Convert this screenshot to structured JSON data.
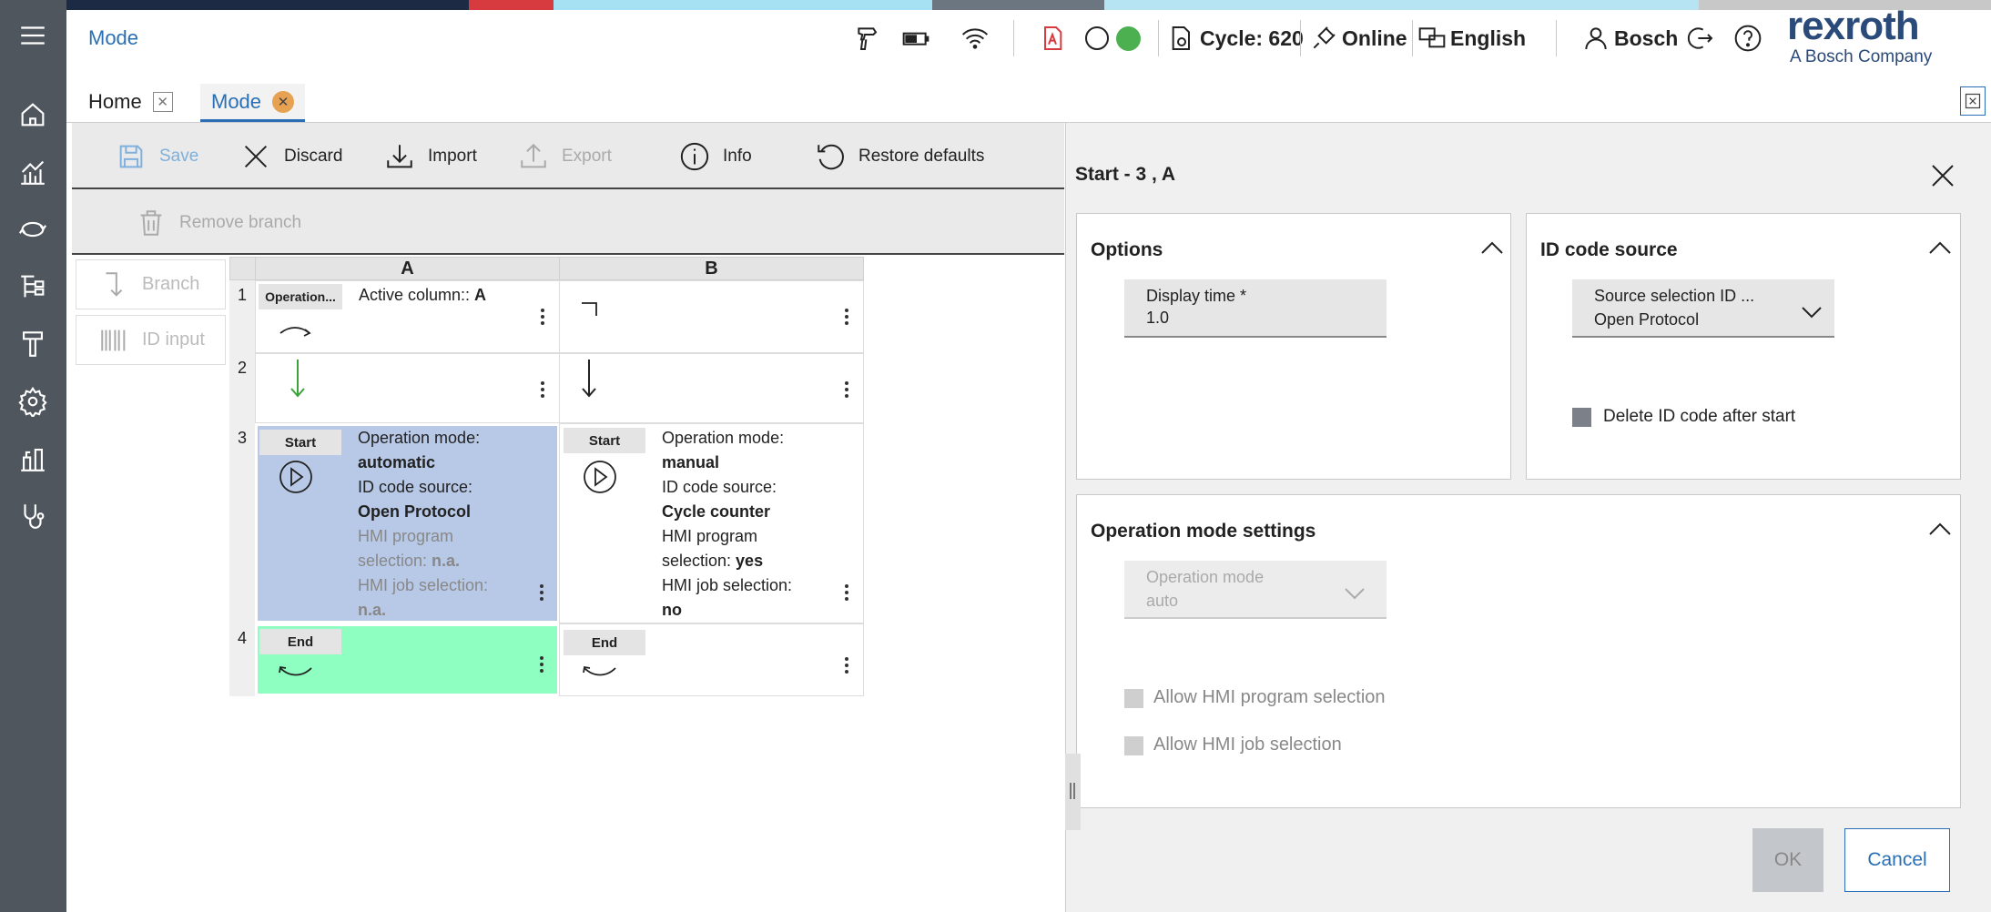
{
  "colors": {
    "sidebar": "#50565d",
    "accent": "#2a6fb5",
    "selected_cell": "#b8c9e8",
    "end_cell": "#8effc0",
    "start_arrow": "#3aa33a",
    "strip": [
      "#1c2b43",
      "#d73a3f",
      "#a6e0f3",
      "#6c7680",
      "#b6e4f3",
      "#c8c8c8"
    ]
  },
  "header": {
    "title": "Mode",
    "cycle": "Cycle: 620",
    "status": "Online",
    "language": "English",
    "user": "Bosch",
    "logo_main": "rexroth",
    "logo_sub": "A Bosch Company"
  },
  "tabs": [
    {
      "label": "Home"
    },
    {
      "label": "Mode"
    }
  ],
  "toolbar": {
    "save": "Save",
    "discard": "Discard",
    "import": "Import",
    "export": "Export",
    "info": "Info",
    "restore": "Restore defaults",
    "remove_branch": "Remove branch"
  },
  "palette": {
    "branch": "Branch",
    "id_input": "ID input"
  },
  "grid": {
    "columns": [
      "A",
      "B"
    ],
    "rows": [
      "1",
      "2",
      "3",
      "4"
    ],
    "r1a_chip": "Operation...",
    "r1a_label": "Active column:: ",
    "r1a_value": "A",
    "start_chip": "Start",
    "end_chip": "End",
    "r3a": {
      "l1": "Operation mode:",
      "v1": "automatic",
      "l2": "ID code source:",
      "v2": "Open Protocol",
      "l3": "HMI program",
      "l4": "selection: ",
      "v4": "n.a.",
      "l5": "HMI job selection:",
      "v5": "n.a."
    },
    "r3b": {
      "l1": "Operation mode:",
      "v1": "manual",
      "l2": "ID code source:",
      "v2": "Cycle counter",
      "l3": "HMI program",
      "l4": "selection: ",
      "v4": "yes",
      "l5": "HMI job selection:",
      "v5": "no"
    }
  },
  "panel": {
    "title": "Start - 3 , A",
    "options": {
      "title": "Options",
      "display_time_label": "Display time *",
      "display_time_value": "1.0"
    },
    "id_source": {
      "title": "ID code source",
      "select_label": "Source selection ID ...",
      "select_value": "Open Protocol",
      "delete_label": "Delete ID code after start"
    },
    "op_mode": {
      "title": "Operation mode settings",
      "select_label": "Operation mode",
      "select_value": "auto",
      "allow_program": "Allow HMI program selection",
      "allow_job": "Allow HMI job selection"
    },
    "ok": "OK",
    "cancel": "Cancel"
  }
}
